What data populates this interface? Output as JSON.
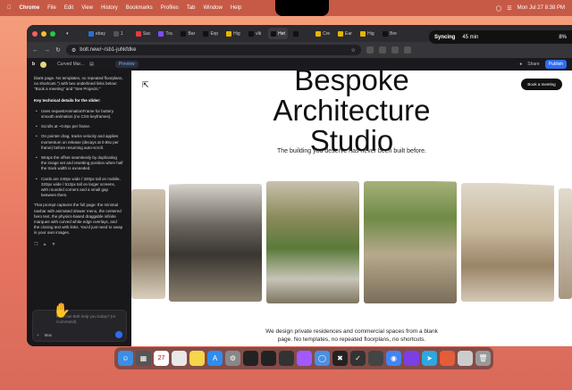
{
  "menubar": {
    "app": "Chrome",
    "items": [
      "File",
      "Edit",
      "View",
      "History",
      "Bookmarks",
      "Profiles",
      "Tab",
      "Window",
      "Help"
    ],
    "datetime": "Mon Jul 27  8:38 PM"
  },
  "sync": {
    "label": "Syncing",
    "time": "45 min",
    "battery": "8%"
  },
  "tabs": [
    {
      "label": "ebay",
      "color": "#2a6fd6"
    },
    {
      "label": "1",
      "color": "#555"
    },
    {
      "label": "Sac",
      "color": "#e23c3c"
    },
    {
      "label": "Tra",
      "color": "#7d4cff"
    },
    {
      "label": "Bar",
      "color": "#111"
    },
    {
      "label": "Exp",
      "color": "#111"
    },
    {
      "label": "Hig",
      "color": "#e8b400"
    },
    {
      "label": "vlk",
      "color": "#111"
    },
    {
      "label": "Het",
      "color": "#111",
      "active": true
    },
    {
      "label": "",
      "color": "#111"
    },
    {
      "label": "Cre",
      "color": "#e8b400"
    },
    {
      "label": "Ear",
      "color": "#e8b400"
    },
    {
      "label": "Hig",
      "color": "#e8b400"
    },
    {
      "label": "Bre",
      "color": "#111"
    }
  ],
  "address": {
    "url": "bolt.new/~/sb1-juhkfdke"
  },
  "appbar": {
    "project": "Curved Mar...",
    "preview_tab": "Preview",
    "share": "Share",
    "publish": "Publish"
  },
  "sidebar": {
    "intro": "blank page. No templates, no repeated floorplans, no shortcuts.\") with two underlined links below: \"Book a meeting\" and \"See Projects.\"",
    "heading": "Key technical details for the slider:",
    "bullets": [
      "Uses requestAnimationFrame for buttery smooth animation (no CSS keyframes).",
      "Scrolls at ~0.8px per frame.",
      "On pointer drag, tracks velocity and applies momentum on release (decays at 0.95x per frame) before resuming auto-scroll.",
      "Wraps the offset seamlessly by duplicating the image set and resetting position when half the track width is exceeded.",
      "Cards are 240px wide / 320px tall on mobile, 320px wide / 512px tall on larger screens, with rounded corners and a small gap between them."
    ],
    "closing": "That prompt captures the full page: the minimal navbar with animated drawer menu, the centered hero text, the physics-based draggable infinite marquee with curved white edge overlays, and the closing text with links. You'd just need to swap in your own images.",
    "chat_placeholder": "How can Bolt help you today? (or /command)",
    "model": "Max"
  },
  "site": {
    "title_line1": "Bespoke",
    "title_line2": "Architecture",
    "title_line3": "Studio",
    "subtitle": "The building you deserve has never been built before.",
    "book_button": "Book a meeting",
    "desc_line1": "We design private residences and commercial spaces from a blank",
    "desc_line2": "page. No templates, no repeated floorplans, no shortcuts."
  }
}
